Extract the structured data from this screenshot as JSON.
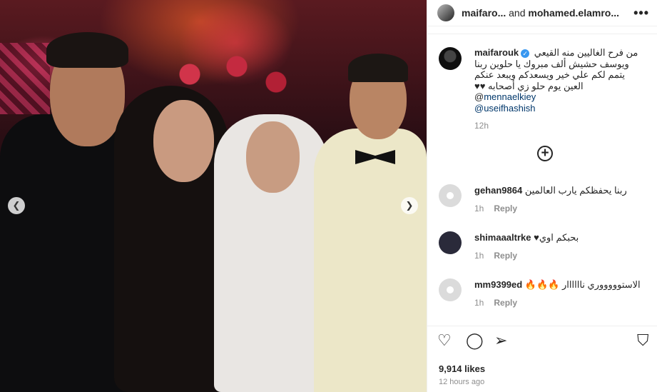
{
  "post": {
    "header": {
      "user1": "maifaro...",
      "joiner": " and ",
      "user2": "mohamed.elamro..."
    },
    "caption": {
      "username": "maifarouk",
      "text": "من فرح الغاليين منه القيعي ويوسف حشيش ألف مبروك يا حلوين ربنا يتمم لكم علي خير ويسعدكم ويبعد عنكم العين يوم حلو زي أصحابه ♥♥ @",
      "mention1": "mennaelkiey",
      "mention2": "@useifhashish",
      "time": "12h"
    },
    "comments": [
      {
        "username": "gehan9864",
        "text": "ربنا يحفظكم يارب العالمين",
        "time": "1h",
        "reply": "Reply"
      },
      {
        "username": "shimaaaltrke",
        "text": "بحبكم اوي♥",
        "time": "1h",
        "reply": "Reply"
      },
      {
        "username": "mm9399ed",
        "text": "الاستوووووري ناااااار 🔥🔥🔥",
        "time": "1h",
        "reply": "Reply"
      }
    ],
    "likes": "9,914 likes",
    "posted": "12 hours ago"
  },
  "icons": {
    "more": "more-icon",
    "add": "add-comment-icon",
    "like": "heart-icon",
    "comment": "comment-icon",
    "share": "share-icon",
    "save": "bookmark-icon"
  },
  "colors": {
    "link": "#00376b",
    "verified": "#3897f0",
    "muted": "#8e8e8e"
  }
}
